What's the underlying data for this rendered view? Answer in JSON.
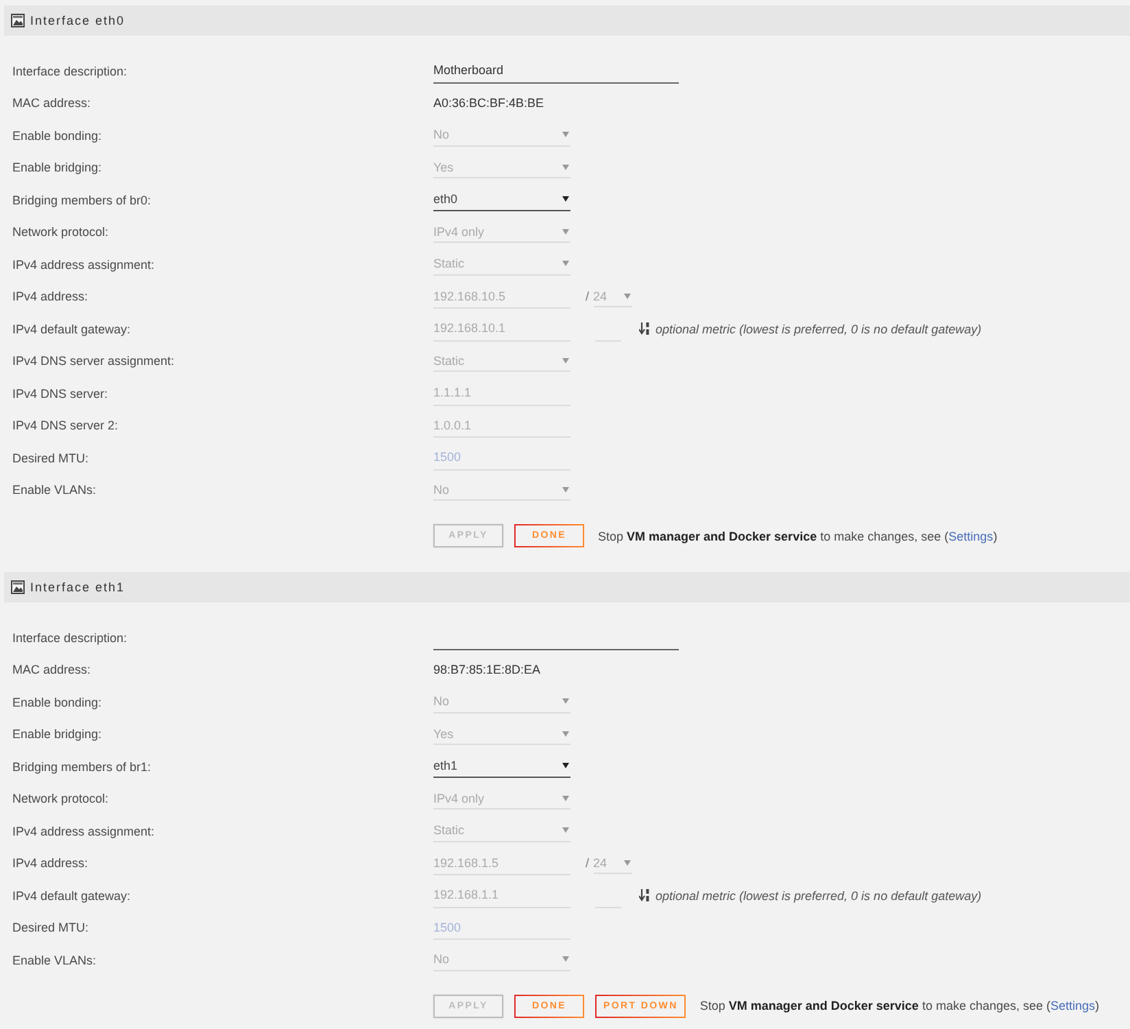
{
  "interfaces": [
    {
      "title": "Interface eth0",
      "fields": [
        {
          "label": "Interface description:",
          "kind": "text",
          "value": "Motherboard",
          "disabled": false
        },
        {
          "label": "MAC address:",
          "kind": "static",
          "value": "A0:36:BC:BF:4B:BE"
        },
        {
          "label": "Enable bonding:",
          "kind": "select",
          "value": "No",
          "disabled": true
        },
        {
          "label": "Enable bridging:",
          "kind": "select",
          "value": "Yes",
          "disabled": true
        },
        {
          "label": "Bridging members of br0:",
          "kind": "select",
          "value": "eth0",
          "disabled": false
        },
        {
          "label": "Network protocol:",
          "kind": "select",
          "value": "IPv4 only",
          "disabled": true
        },
        {
          "label": "IPv4 address assignment:",
          "kind": "select",
          "value": "Static",
          "disabled": true
        },
        {
          "label": "IPv4 address:",
          "kind": "address",
          "value": "192.168.10.5",
          "separator": "/",
          "prefix": "24",
          "disabled": true
        },
        {
          "label": "IPv4 default gateway:",
          "kind": "gateway",
          "value": "192.168.10.1",
          "hint": "optional metric (lowest is preferred, 0 is no default gateway)",
          "disabled": true
        },
        {
          "label": "IPv4 DNS server assignment:",
          "kind": "select",
          "value": "Static",
          "disabled": true
        },
        {
          "label": "IPv4 DNS server:",
          "kind": "text",
          "value": "1.1.1.1",
          "disabled": true
        },
        {
          "label": "IPv4 DNS server 2:",
          "kind": "text",
          "value": "1.0.0.1",
          "disabled": true
        },
        {
          "label": "Desired MTU:",
          "kind": "text",
          "placeholder": "1500",
          "disabled": true
        },
        {
          "label": "Enable VLANs:",
          "kind": "select",
          "value": "No",
          "disabled": true
        }
      ],
      "buttons": [
        {
          "label": "APPLY",
          "disabled": true
        },
        {
          "label": "DONE",
          "disabled": false
        }
      ],
      "notice": {
        "text": "Stop **VM manager and Docker service** to make changes, see (",
        "link": "Settings",
        "after": ")"
      }
    },
    {
      "title": "Interface eth1",
      "fields": [
        {
          "label": "Interface description:",
          "kind": "text",
          "disabled": false
        },
        {
          "label": "MAC address:",
          "kind": "static",
          "value": "98:B7:85:1E:8D:EA"
        },
        {
          "label": "Enable bonding:",
          "kind": "select",
          "value": "No",
          "disabled": true
        },
        {
          "label": "Enable bridging:",
          "kind": "select",
          "value": "Yes",
          "disabled": true
        },
        {
          "label": "Bridging members of br1:",
          "kind": "select",
          "value": "eth1",
          "disabled": false
        },
        {
          "label": "Network protocol:",
          "kind": "select",
          "value": "IPv4 only",
          "disabled": true
        },
        {
          "label": "IPv4 address assignment:",
          "kind": "select",
          "value": "Static",
          "disabled": true
        },
        {
          "label": "IPv4 address:",
          "kind": "address",
          "value": "192.168.1.5",
          "separator": "/",
          "prefix": "24",
          "disabled": true
        },
        {
          "label": "IPv4 default gateway:",
          "kind": "gateway",
          "value": "192.168.1.1",
          "hint": "optional metric (lowest is preferred, 0 is no default gateway)",
          "disabled": true
        },
        {
          "label": "Desired MTU:",
          "kind": "text",
          "placeholder": "1500",
          "disabled": true
        },
        {
          "label": "Enable VLANs:",
          "kind": "select",
          "value": "No",
          "disabled": true
        }
      ],
      "buttons": [
        {
          "label": "APPLY",
          "disabled": true
        },
        {
          "label": "DONE",
          "disabled": false
        },
        {
          "label": "PORT DOWN",
          "disabled": false
        }
      ],
      "notice": {
        "text": "Stop **VM manager and Docker service** to make changes, see (",
        "link": "Settings",
        "after": ")"
      }
    }
  ]
}
